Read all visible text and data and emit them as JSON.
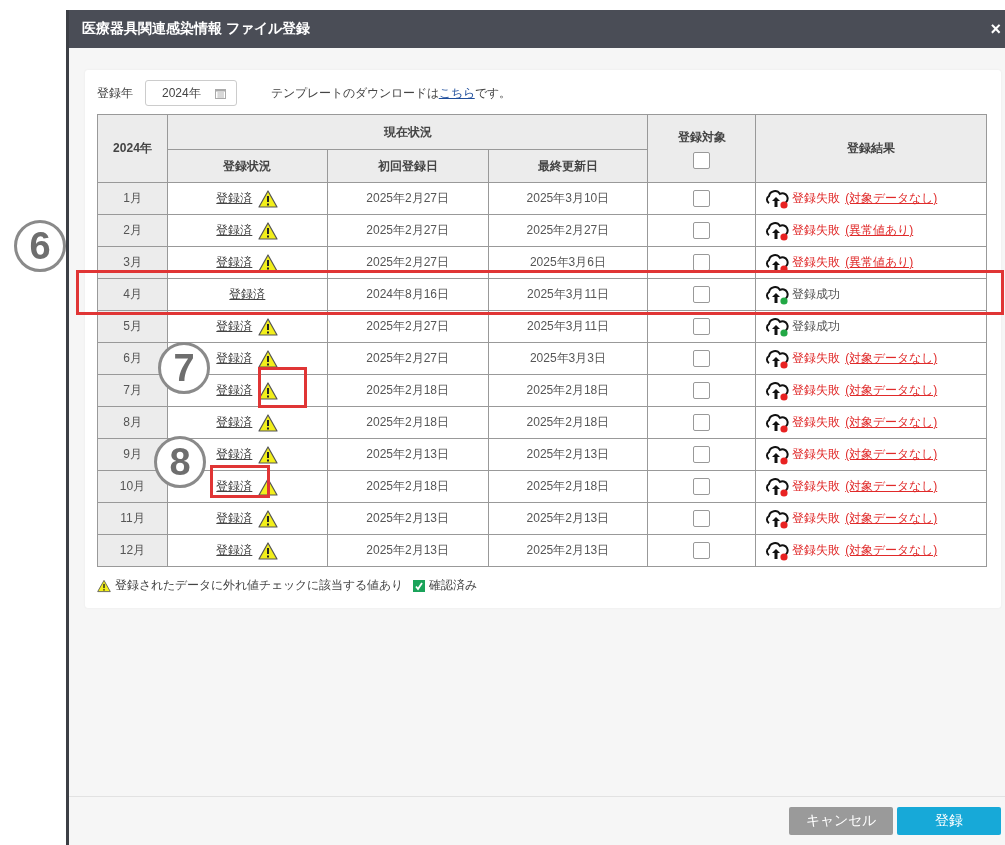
{
  "window": {
    "title": "医療器具関連感染情報 ファイル登録",
    "close": "×"
  },
  "year_field": {
    "label": "登録年",
    "value": "2024年"
  },
  "template_note": {
    "before": "テンプレートのダウンロードは",
    "link": "こちら",
    "after": "です。"
  },
  "table": {
    "corner": "2024年",
    "group_header": "現在状況",
    "columns": [
      "登録状況",
      "初回登録日",
      "最終更新日"
    ],
    "target_header": "登録対象",
    "target_all_checked": false,
    "result_header": "登録結果",
    "rows": [
      {
        "month": "1月",
        "status": "登録済",
        "warning": true,
        "first": "2025年2月27日",
        "last": "2025年3月10日",
        "checked": false,
        "result": {
          "kind": "failure",
          "text": "登録失敗",
          "reason": "(対象データなし)"
        }
      },
      {
        "month": "2月",
        "status": "登録済",
        "warning": true,
        "first": "2025年2月27日",
        "last": "2025年2月27日",
        "checked": false,
        "result": {
          "kind": "failure",
          "text": "登録失敗",
          "reason": "(異常値あり)"
        }
      },
      {
        "month": "3月",
        "status": "登録済",
        "warning": true,
        "first": "2025年2月27日",
        "last": "2025年3月6日",
        "checked": false,
        "result": {
          "kind": "failure",
          "text": "登録失敗",
          "reason": "(異常値あり)"
        }
      },
      {
        "month": "4月",
        "status": "登録済",
        "warning": false,
        "first": "2024年8月16日",
        "last": "2025年3月11日",
        "checked": false,
        "result": {
          "kind": "success",
          "text": "登録成功"
        }
      },
      {
        "month": "5月",
        "status": "登録済",
        "warning": true,
        "first": "2025年2月27日",
        "last": "2025年3月11日",
        "checked": false,
        "result": {
          "kind": "success",
          "text": "登録成功"
        }
      },
      {
        "month": "6月",
        "status": "登録済",
        "warning": true,
        "first": "2025年2月27日",
        "last": "2025年3月3日",
        "checked": false,
        "result": {
          "kind": "failure",
          "text": "登録失敗",
          "reason": "(対象データなし)"
        }
      },
      {
        "month": "7月",
        "status": "登録済",
        "warning": true,
        "first": "2025年2月18日",
        "last": "2025年2月18日",
        "checked": false,
        "result": {
          "kind": "failure",
          "text": "登録失敗",
          "reason": "(対象データなし)"
        }
      },
      {
        "month": "8月",
        "status": "登録済",
        "warning": true,
        "first": "2025年2月18日",
        "last": "2025年2月18日",
        "checked": false,
        "result": {
          "kind": "failure",
          "text": "登録失敗",
          "reason": "(対象データなし)"
        }
      },
      {
        "month": "9月",
        "status": "登録済",
        "warning": true,
        "first": "2025年2月13日",
        "last": "2025年2月13日",
        "checked": false,
        "result": {
          "kind": "failure",
          "text": "登録失敗",
          "reason": "(対象データなし)"
        }
      },
      {
        "month": "10月",
        "status": "登録済",
        "warning": true,
        "first": "2025年2月18日",
        "last": "2025年2月18日",
        "checked": false,
        "result": {
          "kind": "failure",
          "text": "登録失敗",
          "reason": "(対象データなし)"
        }
      },
      {
        "month": "11月",
        "status": "登録済",
        "warning": true,
        "first": "2025年2月13日",
        "last": "2025年2月13日",
        "checked": false,
        "result": {
          "kind": "failure",
          "text": "登録失敗",
          "reason": "(対象データなし)"
        }
      },
      {
        "month": "12月",
        "status": "登録済",
        "warning": true,
        "first": "2025年2月13日",
        "last": "2025年2月13日",
        "checked": false,
        "result": {
          "kind": "failure",
          "text": "登録失敗",
          "reason": "(対象データなし)"
        }
      }
    ]
  },
  "legend": [
    {
      "kind": "warning",
      "text": "登録されたデータに外れ値チェックに該当する値あり"
    },
    {
      "kind": "confirmed",
      "text": "確認済み"
    }
  ],
  "buttons": [
    {
      "kind": "cancel",
      "label": "キャンセル"
    },
    {
      "kind": "primary",
      "label": "登録"
    }
  ],
  "annotations": [
    {
      "kind": "circle",
      "label": "6"
    },
    {
      "kind": "row-box"
    },
    {
      "kind": "circle",
      "label": "7"
    },
    {
      "kind": "icon-box"
    },
    {
      "kind": "circle",
      "label": "8"
    },
    {
      "kind": "text-box"
    }
  ]
}
